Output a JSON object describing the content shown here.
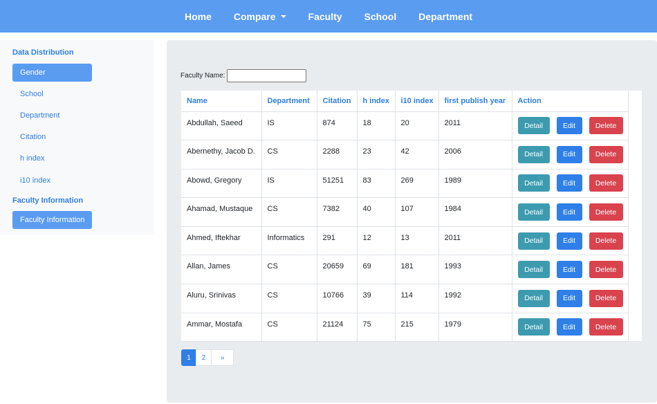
{
  "navbar": {
    "items": [
      {
        "label": "Home"
      },
      {
        "label": "Compare"
      },
      {
        "label": "Faculty"
      },
      {
        "label": "School"
      },
      {
        "label": "Department"
      }
    ]
  },
  "sidebar": {
    "section1_heading": "Data Distribution",
    "section1_items": [
      "Gender",
      "School",
      "Department",
      "Citation",
      "h index",
      "i10 index"
    ],
    "active_item": "Gender",
    "section2_heading": "Faculty Information",
    "section2_item": "Faculty Information"
  },
  "filter": {
    "label": "Faculty Name:",
    "value": ""
  },
  "table": {
    "headers": [
      "Name",
      "Department",
      "Citation",
      "h index",
      "i10 index",
      "first publish year",
      "Action"
    ],
    "rows": [
      [
        "Abdullah, Saeed",
        "IS",
        "874",
        "18",
        "20",
        "2011"
      ],
      [
        "Abernethy, Jacob D.",
        "CS",
        "2288",
        "23",
        "42",
        "2006"
      ],
      [
        "Abowd, Gregory",
        "IS",
        "51251",
        "83",
        "269",
        "1989"
      ],
      [
        "Ahamad, Mustaque",
        "CS",
        "7382",
        "40",
        "107",
        "1984"
      ],
      [
        "Ahmed, Iftekhar",
        "Informatics",
        "291",
        "12",
        "13",
        "2011"
      ],
      [
        "Allan, James",
        "CS",
        "20659",
        "69",
        "181",
        "1993"
      ],
      [
        "Aluru, Srinivas",
        "CS",
        "10766",
        "39",
        "114",
        "1992"
      ],
      [
        "Ammar, Mostafa",
        "CS",
        "21124",
        "75",
        "215",
        "1979"
      ]
    ],
    "action_labels": {
      "detail": "Detail",
      "edit": "Edit",
      "delete": "Delete"
    }
  },
  "pagination": {
    "pages": [
      "1",
      "2"
    ],
    "current": "1",
    "next": "»"
  },
  "colors": {
    "navbar": "#5a9cf0",
    "link": "#2f7fe0",
    "detail": "#3d9bb0",
    "edit": "#2f7fe8",
    "delete": "#d9434e"
  }
}
